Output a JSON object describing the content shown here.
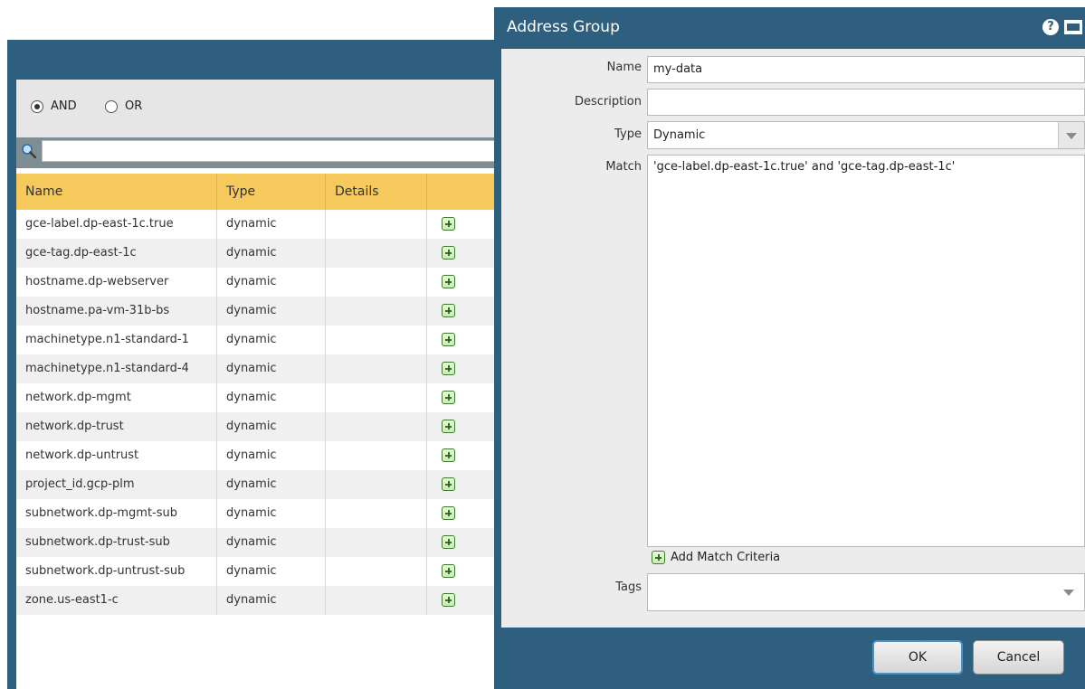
{
  "left_panel": {
    "operator_options": [
      {
        "label": "AND",
        "selected": true
      },
      {
        "label": "OR",
        "selected": false
      }
    ],
    "search": {
      "placeholder": "",
      "value": ""
    },
    "table": {
      "headers": [
        "Name",
        "Type",
        "Details",
        ""
      ],
      "rows": [
        {
          "name": "gce-label.dp-east-1c.true",
          "type": "dynamic"
        },
        {
          "name": "gce-tag.dp-east-1c",
          "type": "dynamic"
        },
        {
          "name": "hostname.dp-webserver",
          "type": "dynamic"
        },
        {
          "name": "hostname.pa-vm-31b-bs",
          "type": "dynamic"
        },
        {
          "name": "machinetype.n1-standard-1",
          "type": "dynamic"
        },
        {
          "name": "machinetype.n1-standard-4",
          "type": "dynamic"
        },
        {
          "name": "network.dp-mgmt",
          "type": "dynamic"
        },
        {
          "name": "network.dp-trust",
          "type": "dynamic"
        },
        {
          "name": "network.dp-untrust",
          "type": "dynamic"
        },
        {
          "name": "project_id.gcp-plm",
          "type": "dynamic"
        },
        {
          "name": "subnetwork.dp-mgmt-sub",
          "type": "dynamic"
        },
        {
          "name": "subnetwork.dp-trust-sub",
          "type": "dynamic"
        },
        {
          "name": "subnetwork.dp-untrust-sub",
          "type": "dynamic"
        },
        {
          "name": "zone.us-east1-c",
          "type": "dynamic"
        }
      ]
    }
  },
  "dialog": {
    "title": "Address Group",
    "fields": {
      "name_label": "Name",
      "name_value": "my-data",
      "description_label": "Description",
      "description_value": "",
      "type_label": "Type",
      "type_value": "Dynamic",
      "match_label": "Match",
      "match_value": "'gce-label.dp-east-1c.true' and 'gce-tag.dp-east-1c'",
      "tags_label": "Tags",
      "tags_value": ""
    },
    "add_match_label": "Add Match Criteria",
    "ok_label": "OK",
    "cancel_label": "Cancel",
    "help_icon": "?"
  },
  "colors": {
    "window_frame": "#2f5f7f",
    "table_header": "#f5c95c",
    "dialog_body": "#ececec",
    "ok_focus": "#4a93c8"
  }
}
